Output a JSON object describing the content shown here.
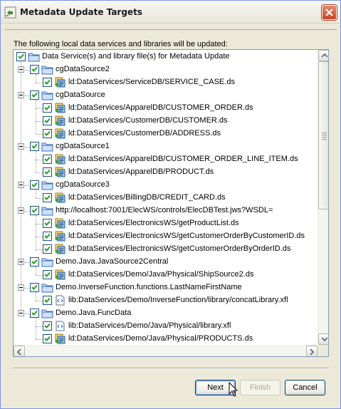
{
  "window": {
    "title": "Metadata Update Targets",
    "instruction": "The following local data services and libraries will be updated:"
  },
  "tree": {
    "root": {
      "label": "Data Service(s) and library file(s) for Metadata Update",
      "checked": true
    },
    "groups": [
      {
        "label": "cgDataSource2",
        "checked": true,
        "items": [
          {
            "label": "ld:DataServices/ServiceDB/SERVICE_CASE.ds",
            "icon": "data-service-icon",
            "checked": true
          }
        ]
      },
      {
        "label": "cgDataSource",
        "checked": true,
        "items": [
          {
            "label": "ld:DataServices/ApparelDB/CUSTOMER_ORDER.ds",
            "icon": "data-service-icon",
            "checked": true
          },
          {
            "label": "ld:DataServices/CustomerDB/CUSTOMER.ds",
            "icon": "data-service-icon",
            "checked": true
          },
          {
            "label": "ld:DataServices/CustomerDB/ADDRESS.ds",
            "icon": "data-service-icon",
            "checked": true
          }
        ]
      },
      {
        "label": "cgDataSource1",
        "checked": true,
        "items": [
          {
            "label": "ld:DataServices/ApparelDB/CUSTOMER_ORDER_LINE_ITEM.ds",
            "icon": "data-service-icon",
            "checked": true
          },
          {
            "label": "ld:DataServices/ApparelDB/PRODUCT.ds",
            "icon": "data-service-icon",
            "checked": true
          }
        ]
      },
      {
        "label": "cgDataSource3",
        "checked": true,
        "items": [
          {
            "label": "ld:DataServices/BillingDB/CREDIT_CARD.ds",
            "icon": "data-service-icon",
            "checked": true
          }
        ]
      },
      {
        "label": "http://localhost:7001/ElecWS/controls/ElecDBTest.jws?WSDL=",
        "checked": true,
        "items": [
          {
            "label": "ld:DataServices/ElectronicsWS/getProductList.ds",
            "icon": "data-service-icon",
            "checked": true
          },
          {
            "label": "ld:DataServices/ElectronicsWS/getCustomerOrderByCustomerID.ds",
            "icon": "data-service-icon",
            "checked": true
          },
          {
            "label": "ld:DataServices/ElectronicsWS/getCustomerOrderByOrderID.ds",
            "icon": "data-service-icon",
            "checked": true
          }
        ]
      },
      {
        "label": "Demo.Java.JavaSource2Central",
        "checked": true,
        "items": [
          {
            "label": "ld:DataServices/Demo/Java/Physical/ShipSource2.ds",
            "icon": "data-service-icon",
            "checked": true
          }
        ]
      },
      {
        "label": "Demo.InverseFunction.functions.LastNameFirstName",
        "checked": true,
        "items": [
          {
            "label": "lib:DataServices/Demo/InverseFunction/library/concatLibrary.xfl",
            "icon": "library-file-icon",
            "checked": true
          }
        ]
      },
      {
        "label": "Demo.Java.FuncData",
        "checked": true,
        "items": [
          {
            "label": "lib:DataServices/Demo/Java/Physical/library.xfl",
            "icon": "library-file-icon",
            "checked": true
          },
          {
            "label": "ld:DataServices/Demo/Java/Physical/PRODUCTS.ds",
            "icon": "data-service-icon",
            "checked": true
          }
        ]
      }
    ]
  },
  "buttons": {
    "next": "Next",
    "finish": "Finish",
    "cancel": "Cancel"
  },
  "colors": {
    "dialog_background": "#ece9d8",
    "folder": "#5b8ed6",
    "checkbox_border": "#1c5180",
    "close_button": "#c9401f"
  }
}
